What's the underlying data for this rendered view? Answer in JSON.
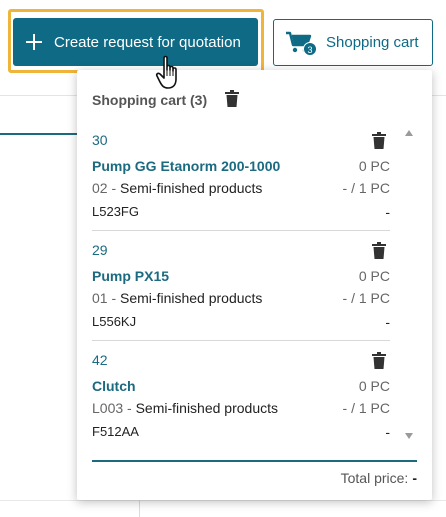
{
  "toolbar": {
    "create_label": "Create request for quotation",
    "cart_label": "Shopping cart",
    "cart_badge": "3"
  },
  "cart": {
    "title": "Shopping cart (3)",
    "items": [
      {
        "position": "30",
        "name": "Pump GG Etanorm 200-1000",
        "qty": "0 PC",
        "variant_code": "02 -",
        "category": "Semi-finished products",
        "ratio": "- / 1 PC",
        "code": "L523FG",
        "extra": "-"
      },
      {
        "position": "29",
        "name": "Pump PX15",
        "qty": "0 PC",
        "variant_code": "01 -",
        "category": "Semi-finished products",
        "ratio": "- / 1 PC",
        "code": "L556KJ",
        "extra": "-"
      },
      {
        "position": "42",
        "name": "Clutch",
        "qty": "0 PC",
        "variant_code": "L003 -",
        "category": "Semi-finished products",
        "ratio": "- / 1 PC",
        "code": "F512AA",
        "extra": "-"
      }
    ],
    "total_label": "Total price:",
    "total_value": "-"
  },
  "colors": {
    "primary": "#0e6a85",
    "highlight": "#f0b43a"
  },
  "icons": {
    "add": "plus-icon",
    "cart": "cart-icon",
    "delete": "trash-icon",
    "cursor": "hand-pointer-icon"
  }
}
